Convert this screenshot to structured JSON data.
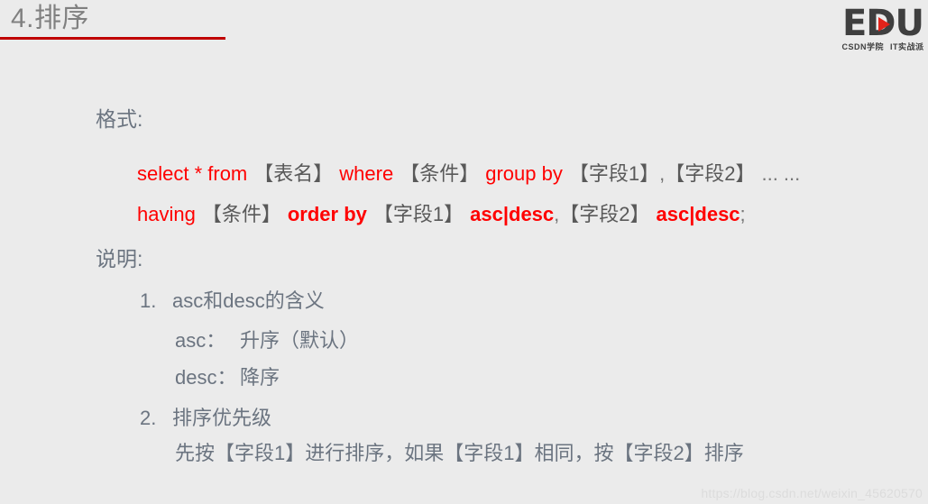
{
  "slide": {
    "title": "4.排序",
    "accent_color": "#c00000",
    "background_color": "#ebebeb",
    "keyword_color": "#ff0000",
    "text_color": "#6b7480"
  },
  "logo": {
    "word": "EDU",
    "subtitle_left": "CSDN学院",
    "subtitle_right": "IT实战派",
    "play_icon": "play-triangle-icon",
    "play_color": "#e2231a"
  },
  "labels": {
    "format": "格式:",
    "explain": "说明:"
  },
  "syntax": {
    "line1": {
      "select": "select * from",
      "table": "【表名】",
      "where": "where",
      "condition": "【条件】",
      "group_by": "group by",
      "field1": "【字段1】",
      "comma": ",",
      "field2": "【字段2】",
      "ellipsis": "... ..."
    },
    "line2": {
      "having": "having",
      "condition": "【条件】",
      "order_by": "order by",
      "field1": "【字段1】",
      "ascdesc1": "asc|desc",
      "comma": ",",
      "field2": "【字段2】",
      "ascdesc2": "asc|desc",
      "semicolon": ";"
    }
  },
  "notes": [
    {
      "index": "1.",
      "heading": "asc和desc的含义",
      "rows": [
        {
          "term": "asc：",
          "desc": "升序（默认）"
        },
        {
          "term": "desc：",
          "desc": "降序"
        }
      ]
    },
    {
      "index": "2.",
      "heading": "排序优先级",
      "rows": [
        {
          "term": "",
          "desc": "先按【字段1】进行排序，如果【字段1】相同，按【字段2】排序"
        }
      ]
    }
  ],
  "watermark": "https://blog.csdn.net/weixin_45620570"
}
